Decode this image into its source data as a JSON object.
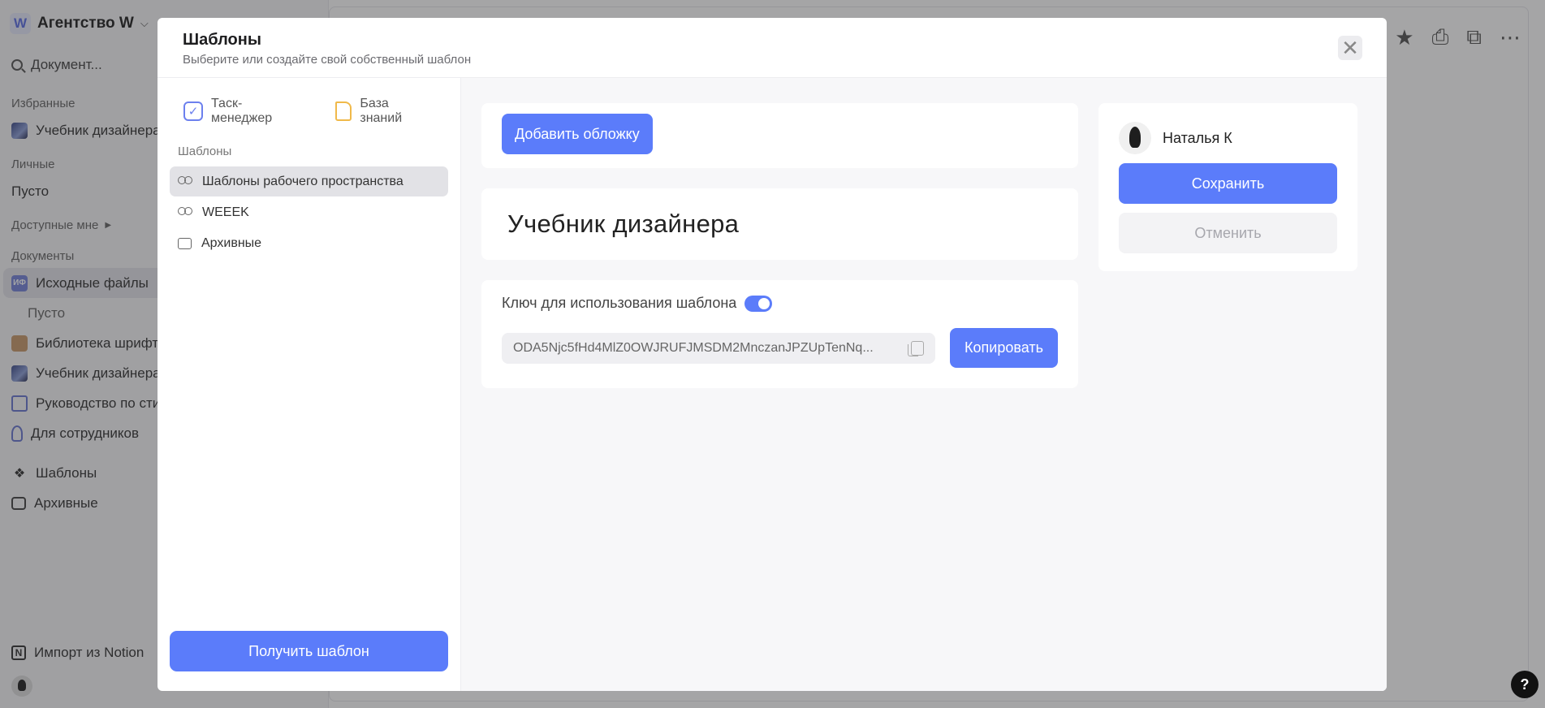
{
  "sidebar": {
    "workspace_logo": "W",
    "workspace_name": "Агентство W",
    "search_placeholder": "Документ...",
    "favorites_label": "Избранные",
    "favorites": [
      {
        "label": "Учебник дизайнера"
      }
    ],
    "personal_label": "Личные",
    "personal_empty": "Пусто",
    "shared_label": "Доступные мне",
    "documents_label": "Документы",
    "documents": [
      {
        "label": "Исходные файлы",
        "icon": "ИФ"
      },
      {
        "label": "Пусто"
      },
      {
        "label": "Библиотека шрифтов"
      },
      {
        "label": "Учебник дизайнера"
      },
      {
        "label": "Руководство по стилю"
      },
      {
        "label": "Для сотрудников"
      }
    ],
    "templates": "Шаблоны",
    "archive": "Архивные",
    "import_notion": "Импорт из Notion",
    "notion_icon_letter": "N"
  },
  "help_label": "?",
  "modal": {
    "title": "Шаблоны",
    "subtitle": "Выберите или создайте свой собственный шаблон",
    "close_icon": "close-icon",
    "type_tabs": [
      {
        "label": "Таск-менеджер",
        "icon": "checkbox-icon"
      },
      {
        "label": "База знаний",
        "icon": "document-icon"
      }
    ],
    "templates_label": "Шаблоны",
    "template_items": [
      {
        "label": "Шаблоны рабочего пространства",
        "icon": "group-icon"
      },
      {
        "label": "WEEEK",
        "icon": "group-icon"
      },
      {
        "label": "Архивные",
        "icon": "archive-icon"
      }
    ],
    "get_template_button": "Получить шаблон",
    "add_cover_button": "Добавить обложку",
    "document_title": "Учебник дизайнера",
    "key_label": "Ключ для использования шаблона",
    "key_toggle_on": true,
    "key_value": "ODA5Njc5fHd4MlZ0OWJRUFJMSDM2MnczanJPZUpTenNq...",
    "copy_button": "Копировать",
    "author_name": "Наталья К",
    "save_button": "Сохранить",
    "cancel_button": "Отменить"
  },
  "colors": {
    "accent": "#5b7cfa",
    "overlay": "rgba(40,40,44,0.42)"
  }
}
